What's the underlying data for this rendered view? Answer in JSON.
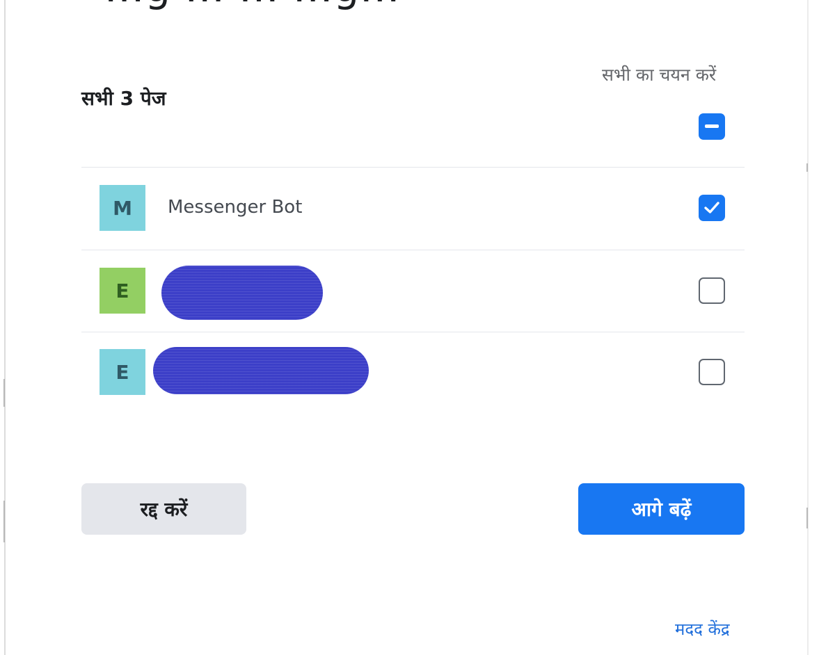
{
  "cropped_heading": "...g ... ... ...g...",
  "header": {
    "title": "सभी 3 पेज",
    "select_all_label": "सभी का चयन करें",
    "select_all_state": "indeterminate"
  },
  "pages": [
    {
      "initial": "M",
      "name": "Messenger Bot",
      "avatar_color": "#7fd3de",
      "checked": true
    },
    {
      "initial": "E",
      "name": "",
      "redacted": true,
      "avatar_color": "#93cf63",
      "checked": false
    },
    {
      "initial": "E",
      "name": "",
      "redacted": true,
      "avatar_color": "#7fd3de",
      "checked": false
    }
  ],
  "buttons": {
    "cancel_label": "रद्द करें",
    "next_label": "आगे बढ़ें"
  },
  "help_link": "मदद केंद्र",
  "colors": {
    "accent": "#1877f2",
    "secondary_button": "#e4e6eb",
    "divider": "#e4e6eb",
    "redaction": "#3c3fc8"
  }
}
